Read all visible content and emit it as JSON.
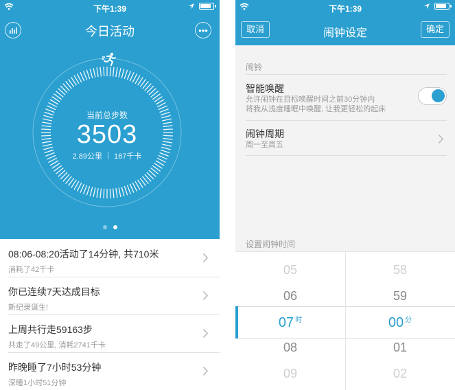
{
  "status": {
    "time": "下午1:39"
  },
  "activity": {
    "title": "今日活动",
    "steps_label": "当前总步数",
    "steps": "3503",
    "distance": "2.89公里",
    "calories": "167千卡",
    "page_count": 2,
    "active_page": 2,
    "items": [
      {
        "title": "08:06-08:20活动了14分钟, 共710米",
        "subtitle": "消耗了42千卡"
      },
      {
        "title": "你已连续7天达成目标",
        "subtitle": "新纪录诞生!"
      },
      {
        "title": "上周共行走59163步",
        "subtitle": "共走了49公里, 消耗2741千卡"
      },
      {
        "title": "昨晚睡了7小时53分钟",
        "subtitle": "深睡1小时51分钟"
      }
    ]
  },
  "alarm": {
    "title": "闹钟设定",
    "cancel": "取消",
    "confirm": "确定",
    "section": "闹铃",
    "smart_wake": {
      "title": "智能唤醒",
      "desc1": "允许闹钟在目标唤醒时间之前30分钟内",
      "desc2": "将我从浅度睡眠中唤醒, 让我更轻松的起床",
      "enabled": true
    },
    "repeat": {
      "title": "闹钟周期",
      "value": "周一至周五"
    },
    "time_section": "设置闹钟时间",
    "hours": [
      "05",
      "06",
      "07",
      "08",
      "09"
    ],
    "minutes": [
      "58",
      "59",
      "00",
      "01",
      "02"
    ],
    "hour_unit": "时",
    "minute_unit": "分"
  },
  "colors": {
    "accent": "#2a9fd0"
  },
  "icons": [
    "wifi-icon",
    "location-arrow-icon",
    "battery-icon",
    "bar-chart-icon",
    "more-icon",
    "runner-icon",
    "chevron-right-icon"
  ]
}
